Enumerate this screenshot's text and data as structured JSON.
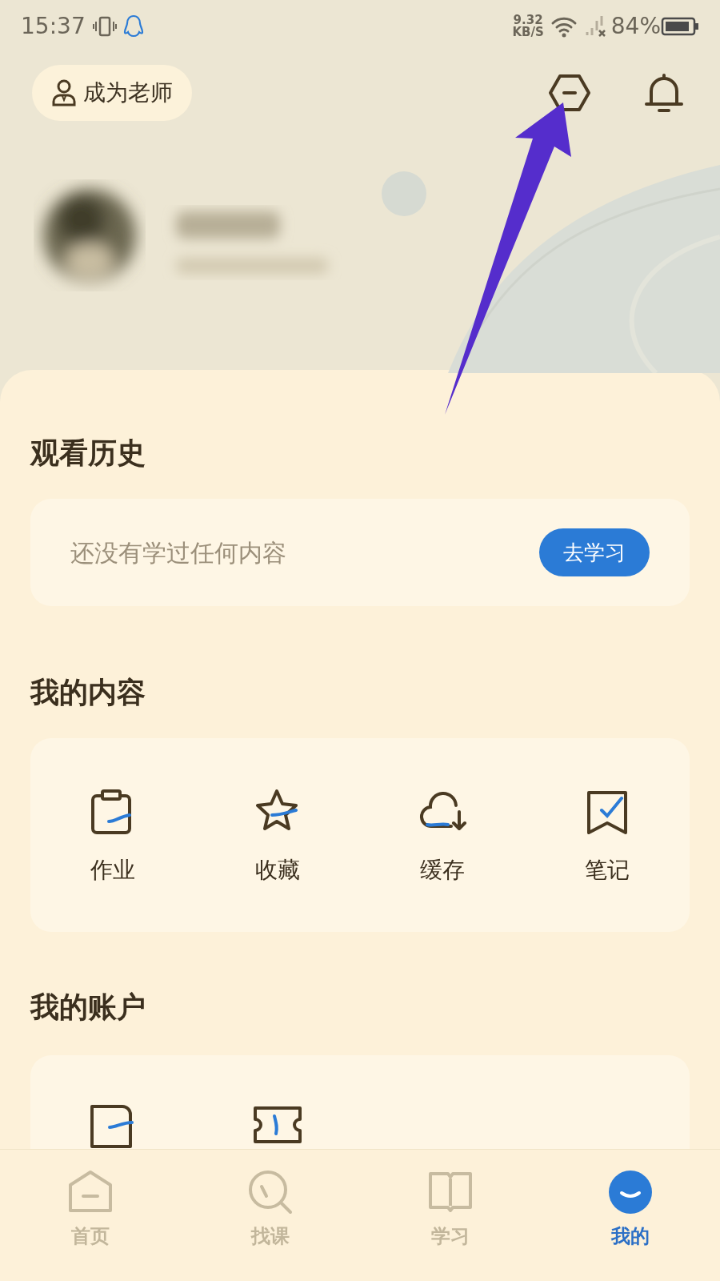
{
  "status_bar": {
    "time": "15:37",
    "net_speed": "9.32",
    "net_unit": "KB/S",
    "battery": "84%"
  },
  "header": {
    "teacher_button": "成为老师"
  },
  "history": {
    "title": "观看历史",
    "empty_text": "还没有学过任何内容",
    "button": "去学习"
  },
  "content": {
    "title": "我的内容",
    "items": [
      {
        "kind": "homework",
        "label": "作业"
      },
      {
        "kind": "favorites",
        "label": "收藏"
      },
      {
        "kind": "cache",
        "label": "缓存"
      },
      {
        "kind": "notes",
        "label": "笔记"
      }
    ]
  },
  "account": {
    "title": "我的账户",
    "items": [
      {
        "kind": "wallet"
      },
      {
        "kind": "coupon"
      }
    ]
  },
  "nav": [
    {
      "kind": "home",
      "label": "首页",
      "selected": false
    },
    {
      "kind": "search",
      "label": "找课",
      "selected": false
    },
    {
      "kind": "study",
      "label": "学习",
      "selected": false
    },
    {
      "kind": "me",
      "label": "我的",
      "selected": true
    }
  ]
}
